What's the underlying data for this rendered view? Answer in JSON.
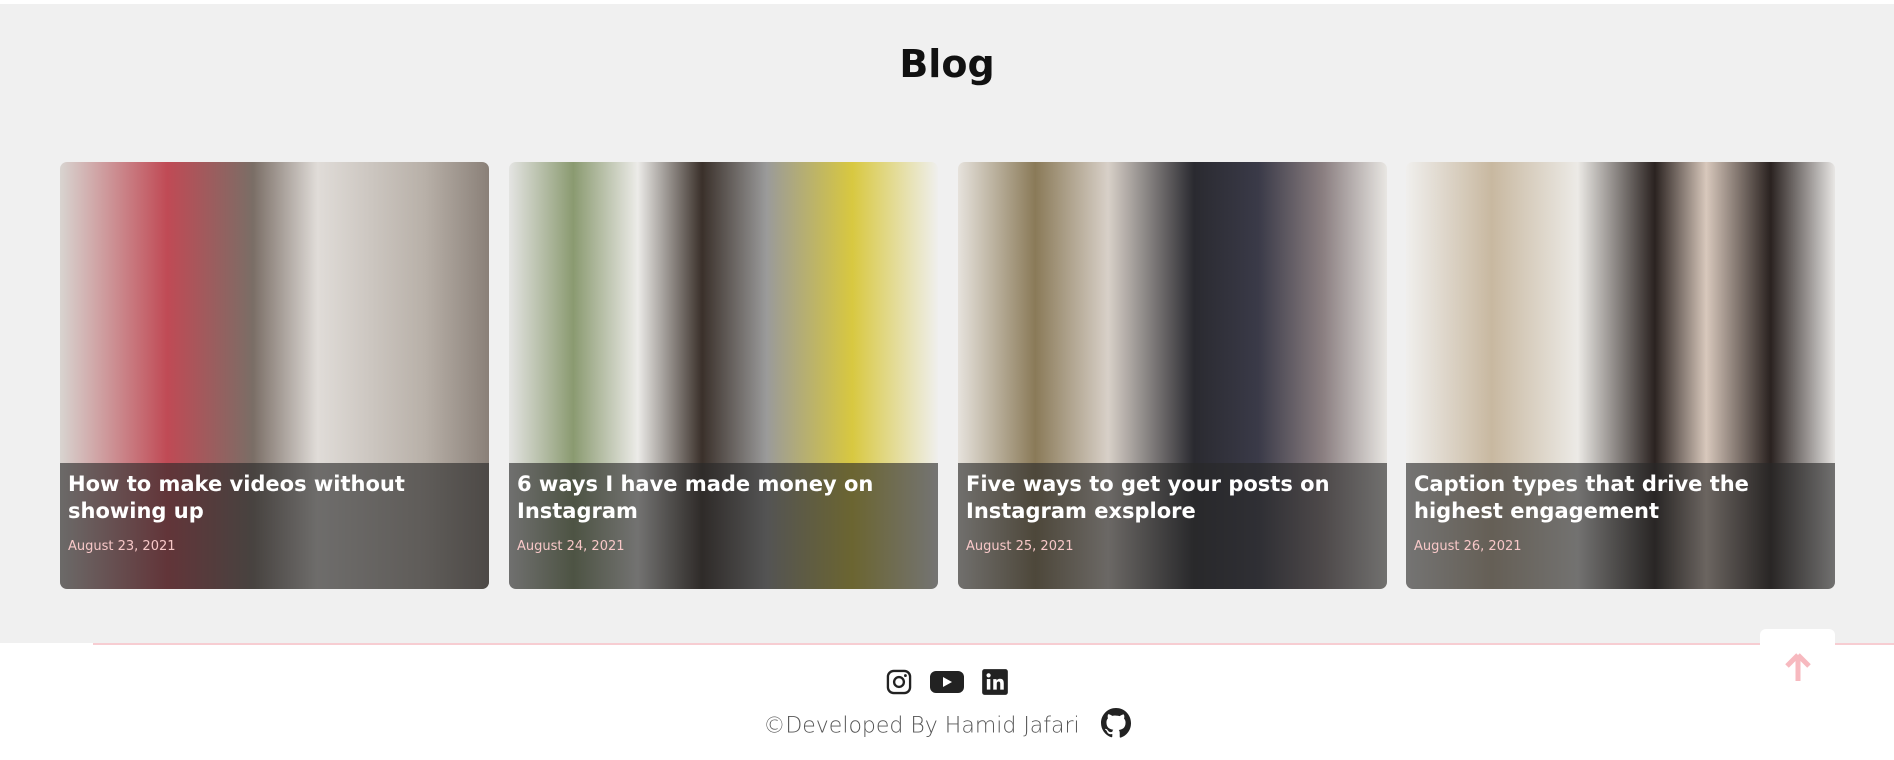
{
  "section_title": "Blog",
  "posts": [
    {
      "title": "How to make videos without showing up",
      "date": "August 23, 2021"
    },
    {
      "title": "6 ways I have made money on Instagram",
      "date": "August 24, 2021"
    },
    {
      "title": "Five ways to get your posts on Instagram exsplore",
      "date": "August 25, 2021"
    },
    {
      "title": "Caption types that drive the highest engagement",
      "date": "August 26, 2021"
    }
  ],
  "footer": {
    "credit": "©Developed By Hamid Jafari"
  },
  "colors": {
    "accent": "#f7b9bf",
    "background": "#f0f0f0"
  }
}
